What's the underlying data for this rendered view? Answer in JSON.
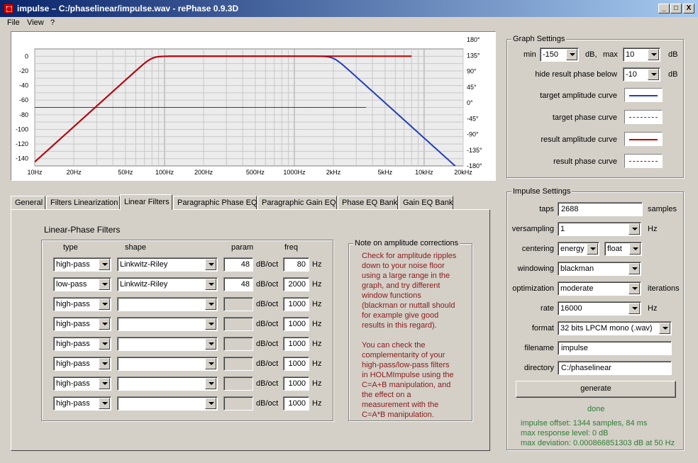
{
  "window": {
    "title": "impulse  –  C:/phaselinear/impulse.wav  -  rePhase 0.9.3D",
    "min_glyph": "_",
    "max_glyph": "□",
    "close_glyph": "X"
  },
  "menu": [
    "File",
    "View",
    "?"
  ],
  "graph": {
    "left_axis": [
      "0",
      "-20",
      "-40",
      "-60",
      "-80",
      "-100",
      "-120",
      "-140"
    ],
    "right_axis": [
      "180°",
      "135°",
      "90°",
      "45°",
      "0°",
      "-45°",
      "-90°",
      "-135°",
      "-180°"
    ],
    "x_axis": [
      "10Hz",
      "20Hz",
      "50Hz",
      "100Hz",
      "200Hz",
      "500Hz",
      "1000Hz",
      "2kHz",
      "5kHz",
      "10kHz",
      "20kHz"
    ]
  },
  "graph_settings": {
    "title": "Graph Settings",
    "min_label": "min",
    "min_value": "-150",
    "db1": "dB,",
    "max_label": "max",
    "max_value": "10",
    "db2": "dB",
    "hide_label": "hide result phase below",
    "hide_value": "-10",
    "db3": "dB",
    "curves": [
      {
        "label": "target amplitude curve",
        "color": "#1f3fbf",
        "style": "solid"
      },
      {
        "label": "target phase curve",
        "color": "#1f3fbf",
        "style": "dashed"
      },
      {
        "label": "result amplitude curve",
        "color": "#c00000",
        "style": "solid"
      },
      {
        "label": "result phase curve",
        "color": "#c00000",
        "style": "dashed"
      }
    ]
  },
  "tabs": [
    "General",
    "Filters Linearization",
    "Linear Filters",
    "Paragraphic Phase EQ",
    "Paragraphic Gain EQ",
    "Phase EQ Bank",
    "Gain EQ Bank"
  ],
  "linear_filters": {
    "title": "Linear-Phase Filters",
    "col_type": "type",
    "col_shape": "shape",
    "col_param": "param",
    "col_freq": "freq",
    "unit_param": "dB/oct",
    "unit_freq": "Hz",
    "rows": [
      {
        "type": "high-pass",
        "shape": "Linkwitz-Riley",
        "param": "48",
        "freq": "80"
      },
      {
        "type": "low-pass",
        "shape": "Linkwitz-Riley",
        "param": "48",
        "freq": "2000"
      },
      {
        "type": "high-pass",
        "shape": "",
        "param": "",
        "freq": "1000"
      },
      {
        "type": "high-pass",
        "shape": "",
        "param": "",
        "freq": "1000"
      },
      {
        "type": "high-pass",
        "shape": "",
        "param": "",
        "freq": "1000"
      },
      {
        "type": "high-pass",
        "shape": "",
        "param": "",
        "freq": "1000"
      },
      {
        "type": "high-pass",
        "shape": "",
        "param": "",
        "freq": "1000"
      },
      {
        "type": "high-pass",
        "shape": "",
        "param": "",
        "freq": "1000"
      }
    ]
  },
  "note": {
    "title": "Note on amplitude corrections",
    "lines": [
      "Check for amplitude ripples",
      "down to your noise floor",
      "using a large range in the",
      "graph, and try different",
      "window functions",
      "(blackman or nuttall should",
      "for example give good",
      "results in this regard).",
      "",
      "You can check the",
      "complementarity of your",
      "high-pass/low-pass filters",
      "in HOLMImpulse using the",
      "C=A+B manipulation, and",
      "the effect on a",
      "measurement with the",
      "C=A*B manipulation."
    ]
  },
  "impulse_settings": {
    "title": "Impulse Settings",
    "taps_label": "taps",
    "taps_value": "2688",
    "taps_unit": "samples",
    "versampling_label": "versampling",
    "versampling_value": "1",
    "versampling_unit": "Hz",
    "centering_label": "centering",
    "centering_value": "energy",
    "centering_value2": "float",
    "windowing_label": "windowing",
    "windowing_value": "blackman",
    "optimization_label": "optimization",
    "optimization_value": "moderate",
    "optimization_unit": "iterations",
    "rate_label": "rate",
    "rate_value": "16000",
    "rate_unit": "Hz",
    "format_label": "format",
    "format_value": "32 bits LPCM mono (.wav)",
    "filename_label": "filename",
    "filename_value": "impulse",
    "directory_label": "directory",
    "directory_value": "C:/phaselinear",
    "generate_label": "generate",
    "status": "done",
    "info": [
      "impulse offset: 1344 samples, 84 ms",
      "max response level: 0 dB",
      "max deviation: 0.000866851303 dB at 50 Hz"
    ]
  }
}
